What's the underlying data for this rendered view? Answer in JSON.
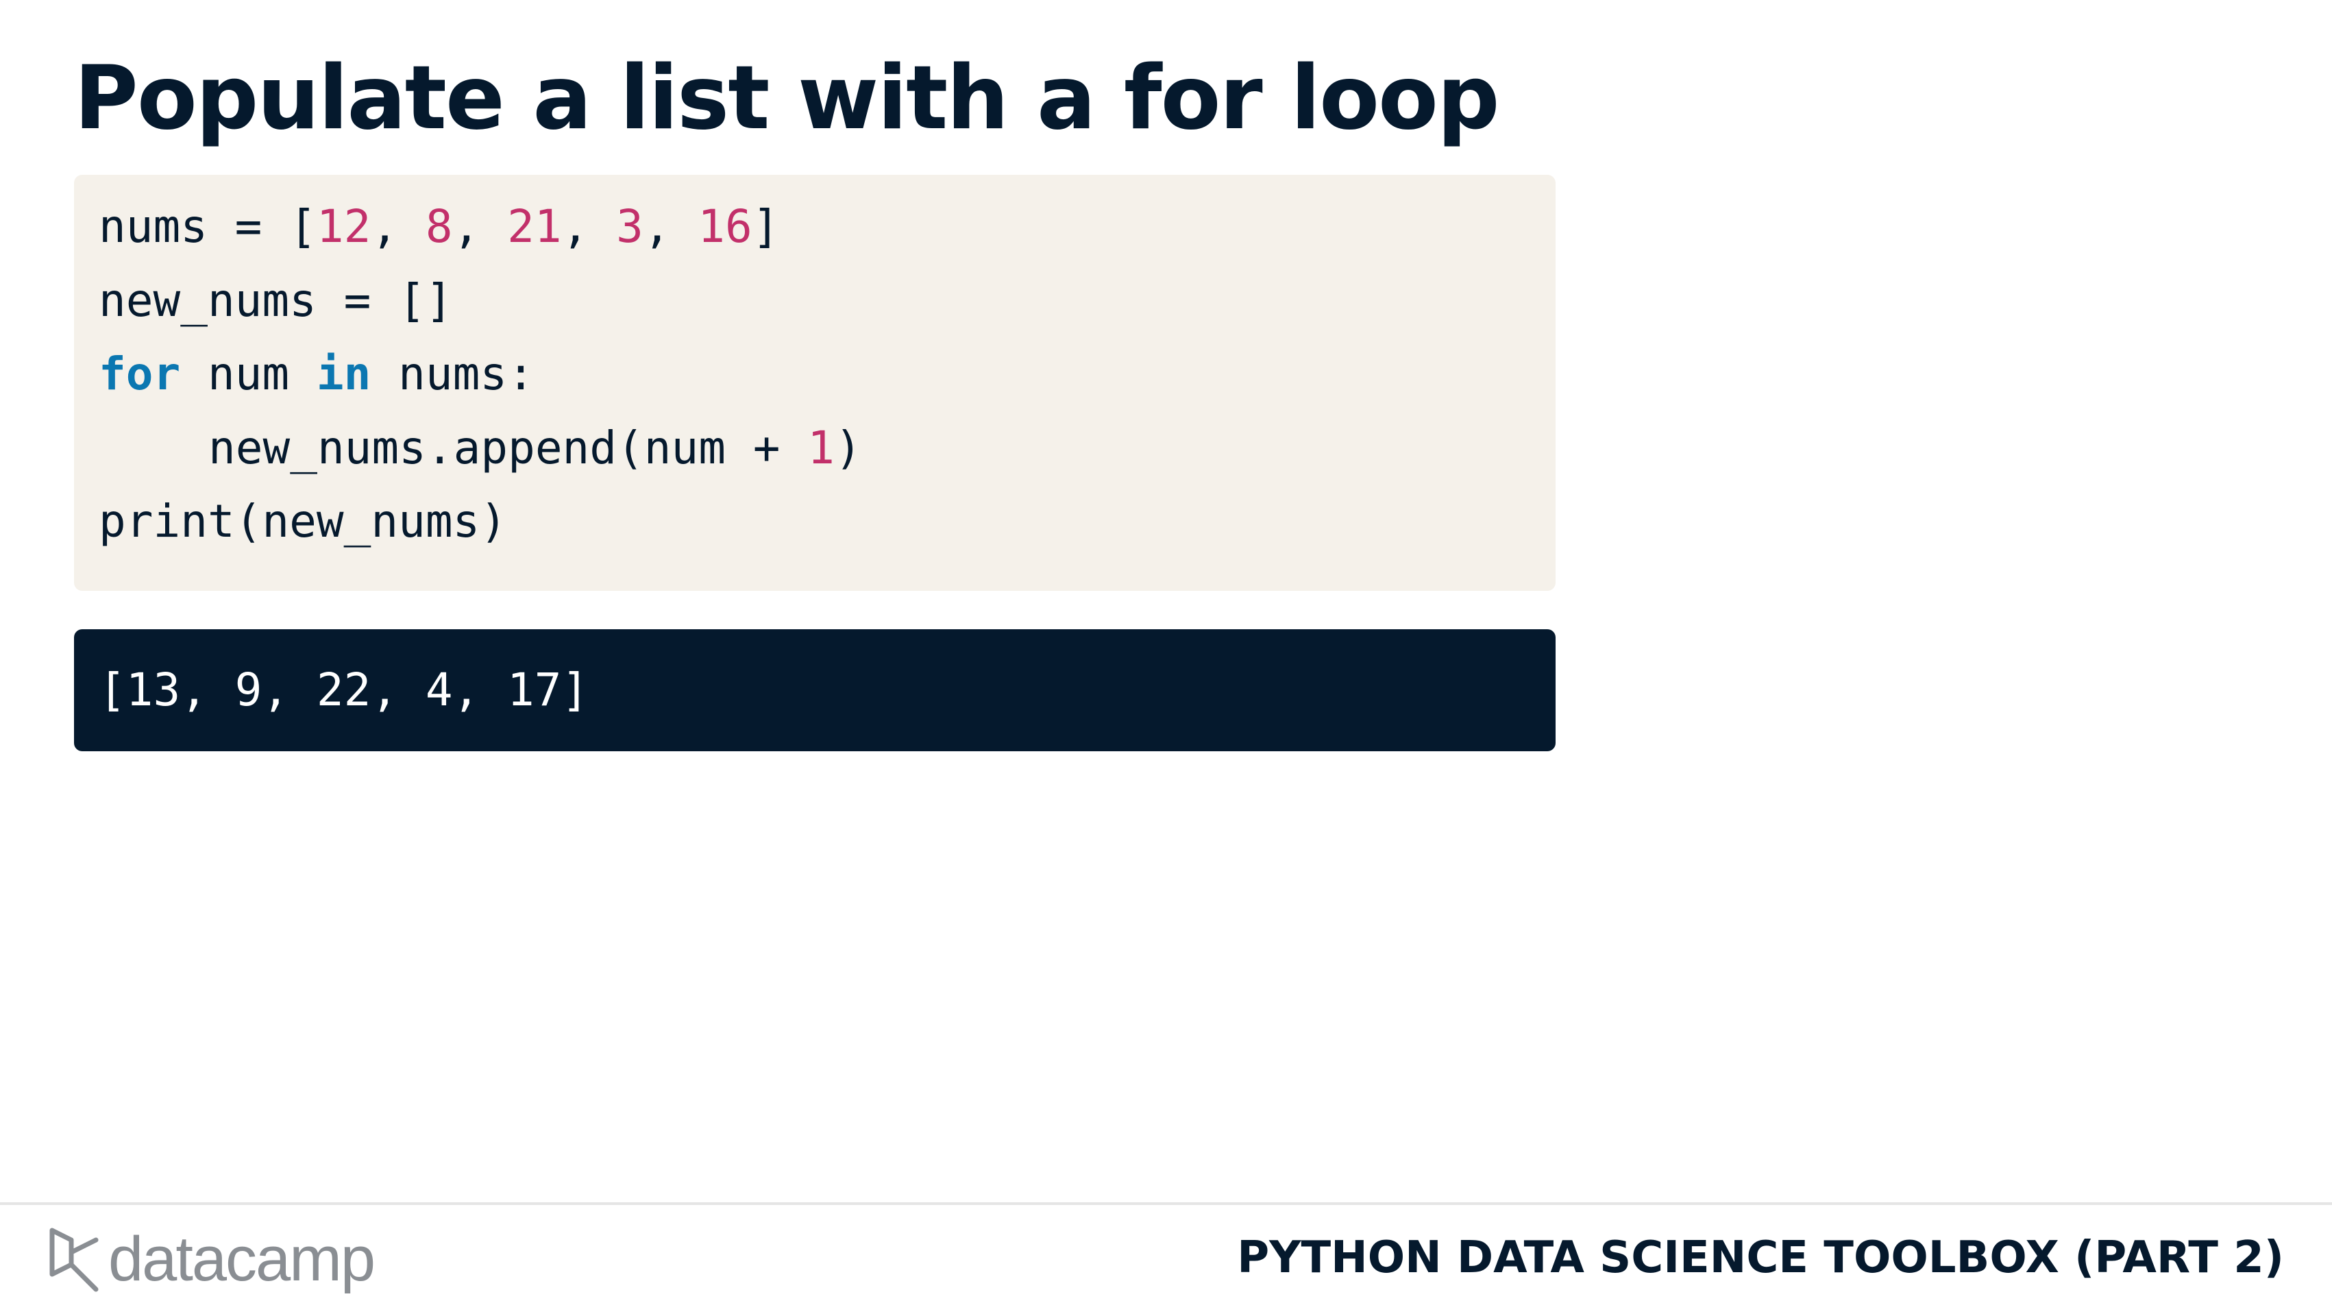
{
  "slide": {
    "title": "Populate a list with a for loop"
  },
  "code": {
    "line1": {
      "a": "nums = [",
      "n1": "12",
      "s1": ", ",
      "n2": "8",
      "s2": ", ",
      "n3": "21",
      "s3": ", ",
      "n4": "3",
      "s4": ", ",
      "n5": "16",
      "b": "]"
    },
    "line2": "new_nums = []",
    "line3": {
      "kw1": "for",
      "a": " num ",
      "kw2": "in",
      "b": " nums:"
    },
    "line4": {
      "a": "new_nums.append(num + ",
      "n1": "1",
      "b": ")"
    },
    "line5": "print(new_nums)"
  },
  "output": {
    "text": "[13, 9, 22, 4, 17]"
  },
  "footer": {
    "logo_text": "datacamp",
    "logo_icon": "datacamp-logo-icon",
    "course_title": "PYTHON DATA SCIENCE TOOLBOX (PART 2)"
  },
  "colors": {
    "navy": "#05192d",
    "code_bg": "#f5f1ea",
    "number": "#c2306a",
    "keyword": "#0b77b1",
    "logo_gray": "#8a8e93"
  }
}
